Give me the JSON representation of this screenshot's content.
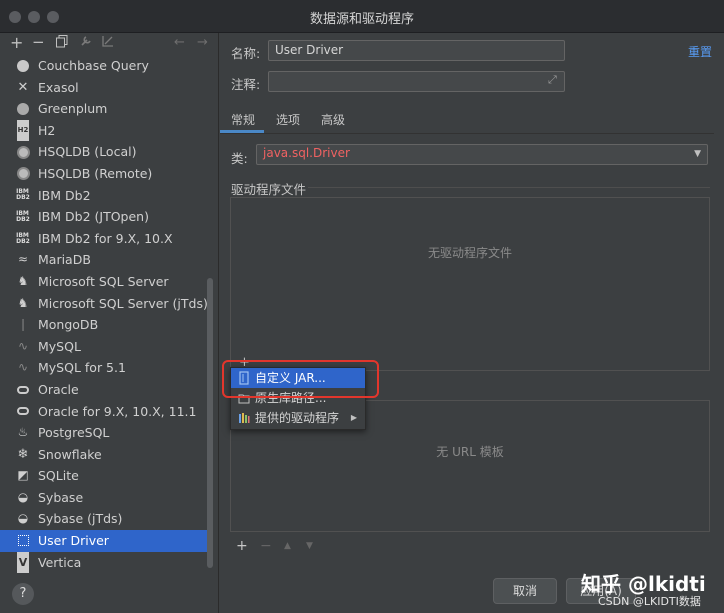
{
  "window": {
    "title": "数据源和驱动程序"
  },
  "left_toolbar": {
    "add": "+",
    "remove": "−"
  },
  "drivers": [
    {
      "label": "Couchbase Query",
      "icon": "couchbase-icon"
    },
    {
      "label": "Exasol",
      "icon": "exasol-icon"
    },
    {
      "label": "Greenplum",
      "icon": "greenplum-icon"
    },
    {
      "label": "H2",
      "icon": "h2-icon"
    },
    {
      "label": "HSQLDB (Local)",
      "icon": "hsqldb-icon"
    },
    {
      "label": "HSQLDB (Remote)",
      "icon": "hsqldb-icon"
    },
    {
      "label": "IBM Db2",
      "icon": "ibm-db2-icon"
    },
    {
      "label": "IBM Db2 (JTOpen)",
      "icon": "ibm-db2-icon"
    },
    {
      "label": "IBM Db2 for 9.X, 10.X",
      "icon": "ibm-db2-icon"
    },
    {
      "label": "MariaDB",
      "icon": "mariadb-icon"
    },
    {
      "label": "Microsoft SQL Server",
      "icon": "sqlserver-icon"
    },
    {
      "label": "Microsoft SQL Server (jTds)",
      "icon": "sqlserver-icon"
    },
    {
      "label": "MongoDB",
      "icon": "mongodb-icon"
    },
    {
      "label": "MySQL",
      "icon": "mysql-icon"
    },
    {
      "label": "MySQL for 5.1",
      "icon": "mysql-icon"
    },
    {
      "label": "Oracle",
      "icon": "oracle-icon"
    },
    {
      "label": "Oracle for 9.X, 10.X, 11.1",
      "icon": "oracle-icon"
    },
    {
      "label": "PostgreSQL",
      "icon": "postgresql-icon"
    },
    {
      "label": "Snowflake",
      "icon": "snowflake-icon"
    },
    {
      "label": "SQLite",
      "icon": "sqlite-icon"
    },
    {
      "label": "Sybase",
      "icon": "sybase-icon"
    },
    {
      "label": "Sybase (jTds)",
      "icon": "sybase-icon"
    },
    {
      "label": "User Driver",
      "icon": "user-driver-icon",
      "selected": true
    },
    {
      "label": "Vertica",
      "icon": "vertica-icon"
    }
  ],
  "form": {
    "name_label": "名称:",
    "name_value": "User Driver",
    "comment_label": "注释:",
    "comment_value": "",
    "reset_label": "重置"
  },
  "tabs": [
    "常规",
    "选项",
    "高级"
  ],
  "general": {
    "class_label": "类:",
    "class_value": "java.sql.Driver",
    "driver_files_label": "驱动程序文件",
    "no_driver_files": "无驱动程序文件",
    "no_url_templates": "无 URL 模板"
  },
  "popup_menu": {
    "items": [
      {
        "label": "自定义 JAR...",
        "highlighted": true
      },
      {
        "label": "原生库路径..."
      },
      {
        "label": "提供的驱动程序",
        "submenu": true
      }
    ]
  },
  "url_toolbar": {
    "add": "+",
    "remove": "−",
    "up": "▲",
    "down": "▼"
  },
  "buttons": {
    "cancel": "取消",
    "apply": "应用(A)"
  },
  "watermark": {
    "main": "知乎 @lkidti",
    "sub": "CSDN @LKIDTI数据"
  },
  "colors": {
    "accent": "#2f65ca",
    "class_text": "#f06262",
    "link": "#589df6",
    "highlight_box": "#e2362c"
  }
}
